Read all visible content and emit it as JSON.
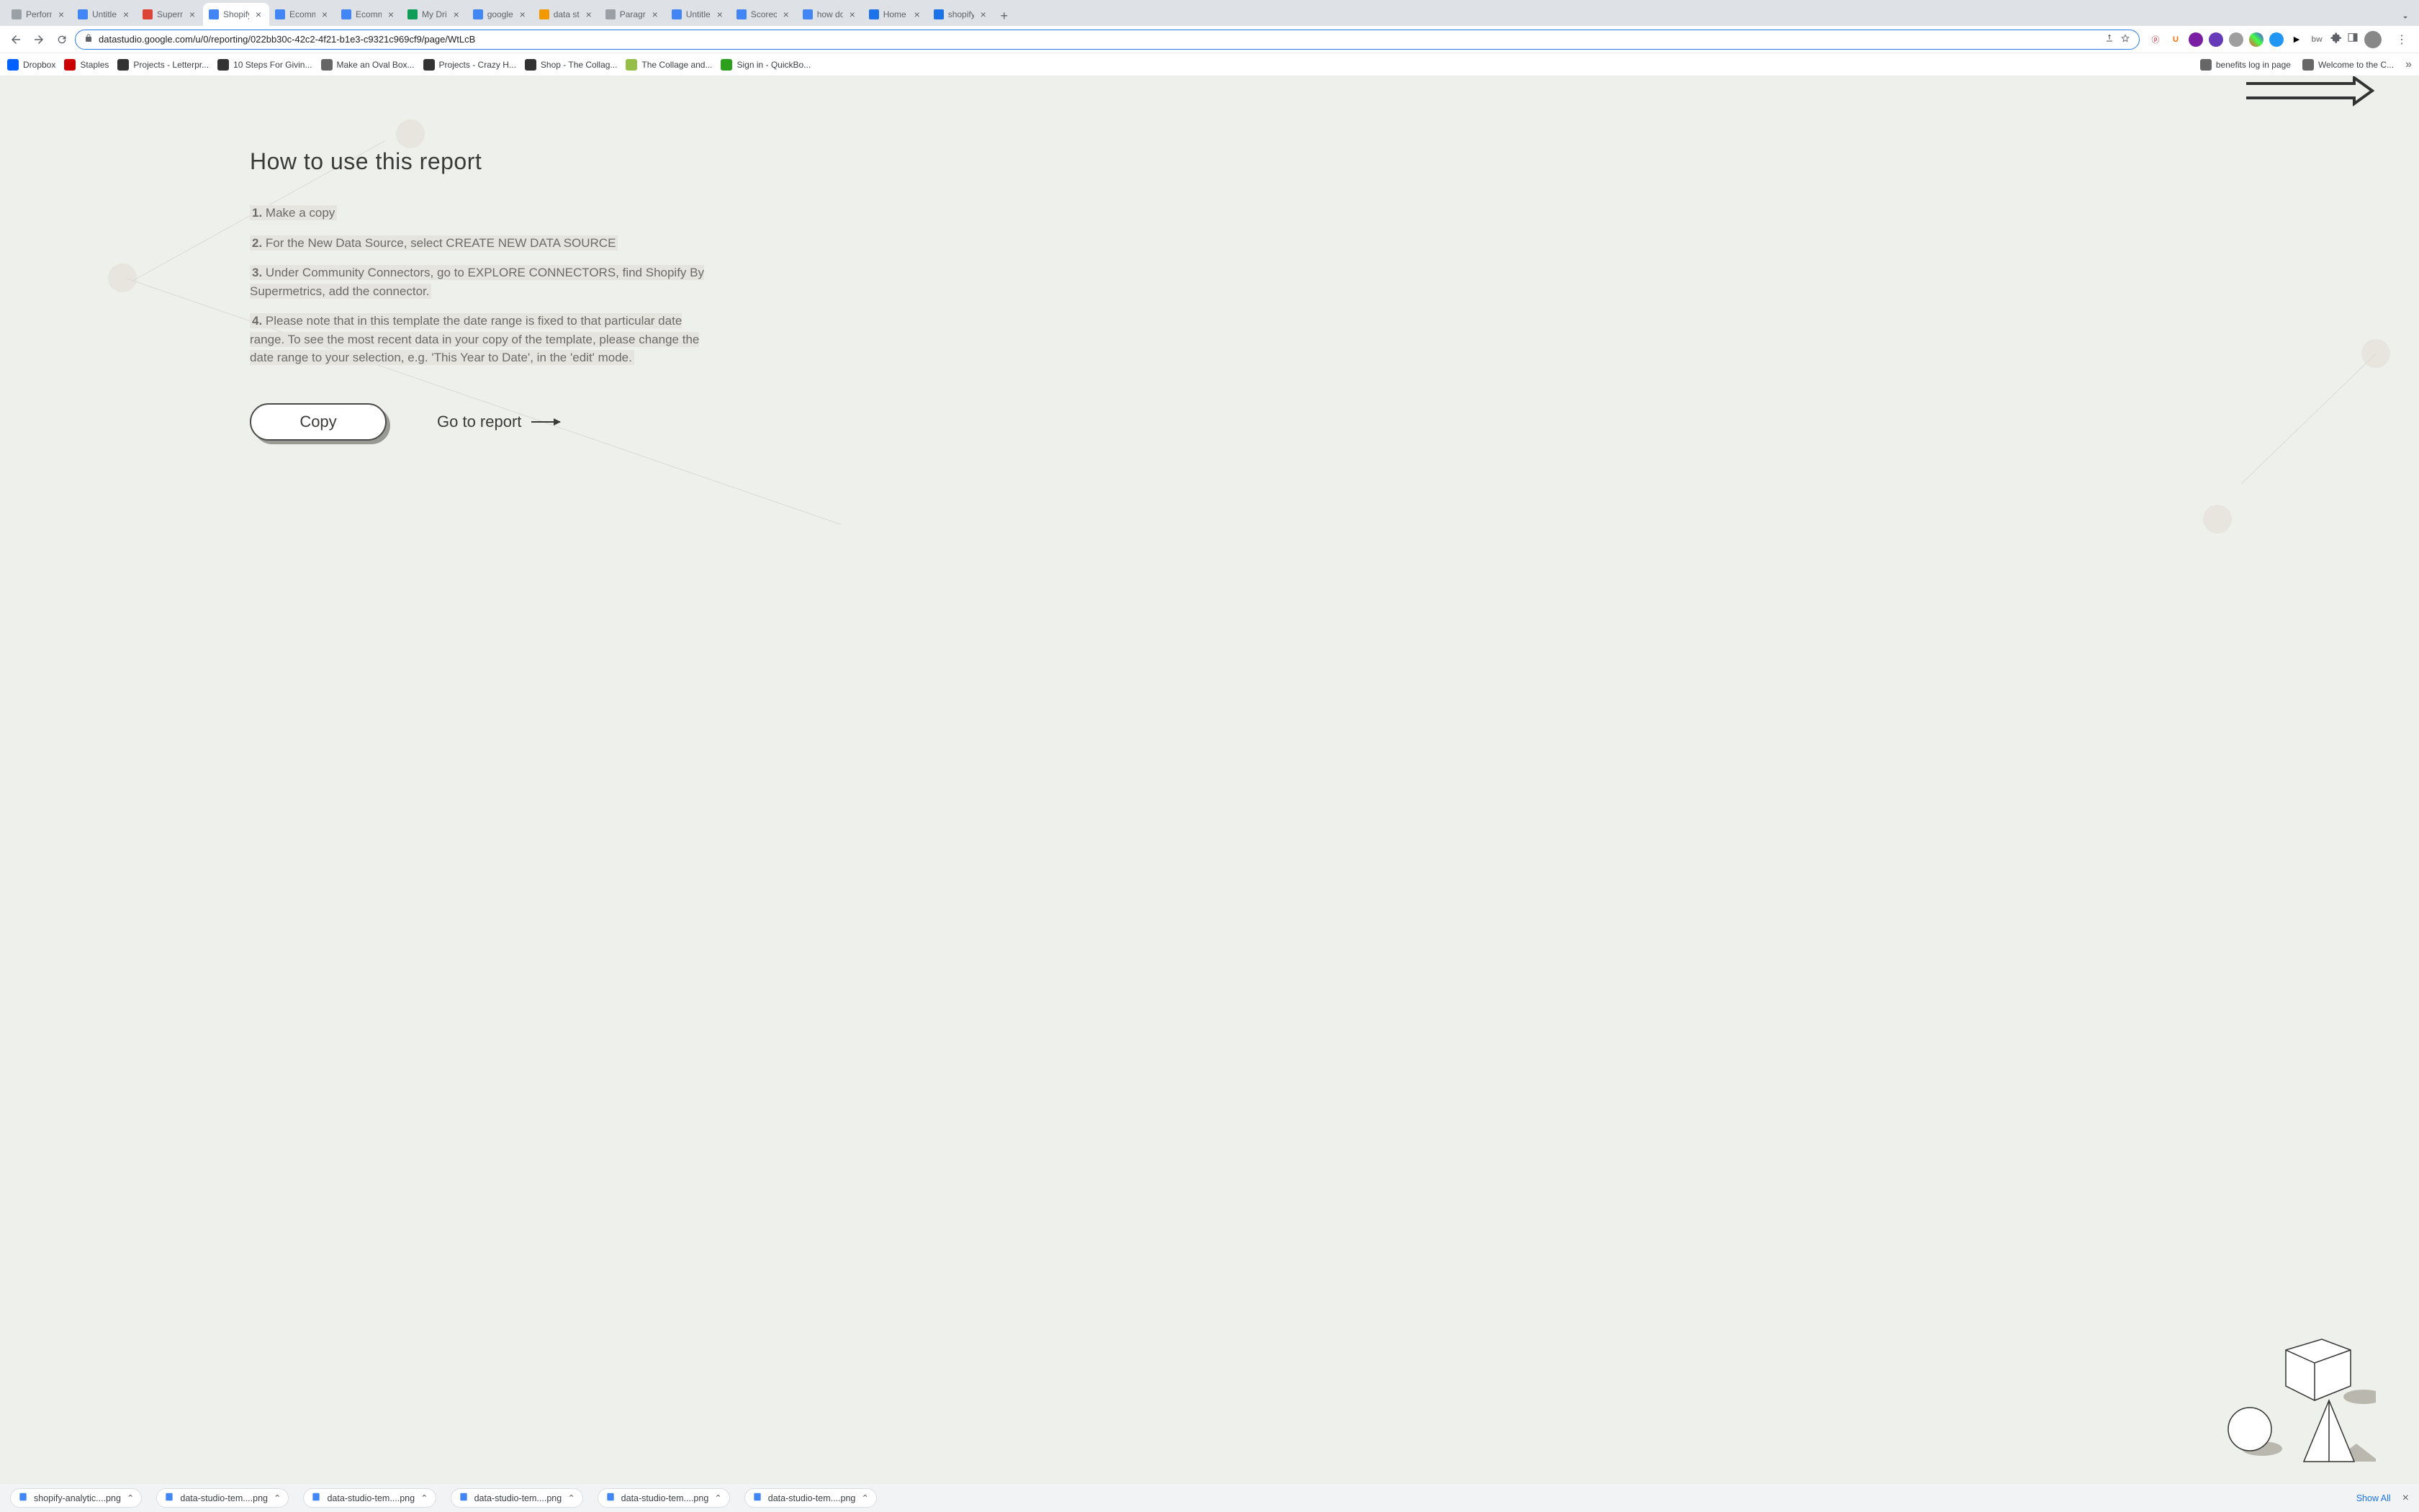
{
  "tabs": [
    {
      "title": "Perform",
      "favicon": "#9aa0a6"
    },
    {
      "title": "Untitle",
      "favicon": "#4285f4"
    },
    {
      "title": "Superm",
      "favicon": "#db4437"
    },
    {
      "title": "Shopify",
      "favicon": "#4285f4",
      "active": true
    },
    {
      "title": "Ecomm",
      "favicon": "#4285f4"
    },
    {
      "title": "Ecomm",
      "favicon": "#4285f4"
    },
    {
      "title": "My Dri",
      "favicon": "#0f9d58"
    },
    {
      "title": "google",
      "favicon": "#4285f4"
    },
    {
      "title": "data st",
      "favicon": "#f29900"
    },
    {
      "title": "Paragra",
      "favicon": "#9aa0a6"
    },
    {
      "title": "Untitle",
      "favicon": "#4285f4"
    },
    {
      "title": "Scorec",
      "favicon": "#4285f4"
    },
    {
      "title": "how do",
      "favicon": "#4285f4"
    },
    {
      "title": "Home",
      "favicon": "#1a73e8"
    },
    {
      "title": "shopify",
      "favicon": "#1a73e8"
    }
  ],
  "address": "datastudio.google.com/u/0/reporting/022bb30c-42c2-4f21-b1e3-c9321c969cf9/page/WtLcB",
  "bookmarks": [
    {
      "label": "Dropbox",
      "color": "#0061ff"
    },
    {
      "label": "Staples",
      "color": "#cc0000"
    },
    {
      "label": "Projects - Letterpr...",
      "color": "#333"
    },
    {
      "label": "10 Steps For Givin...",
      "color": "#333"
    },
    {
      "label": "Make an Oval Box...",
      "color": "#666"
    },
    {
      "label": "Projects - Crazy H...",
      "color": "#333"
    },
    {
      "label": "Shop - The Collag...",
      "color": "#333"
    },
    {
      "label": "The Collage and...",
      "color": "#95bf47"
    },
    {
      "label": "Sign in - QuickBo...",
      "color": "#2ca01c"
    }
  ],
  "bookmarks_right": [
    {
      "label": "benefits log in page"
    },
    {
      "label": "Welcome to the C..."
    }
  ],
  "report": {
    "title": "How to use this report",
    "step1_num": "1.",
    "step1": " Make a copy",
    "step2_num": "2.",
    "step2": " For the New Data Source, select CREATE NEW DATA SOURCE",
    "step3_num": "3.",
    "step3": " Under Community Connectors, go to EXPLORE CONNECTORS, find Shopify By Supermetrics, add the connector.",
    "step4_num": "4.",
    "step4": " Please note that in this template the date range is fixed to that particular date range. To see the most recent data in your copy of the template, please change the date range to your selection, e.g. 'This Year to Date', in the 'edit' mode.",
    "copy_label": "Copy",
    "goto_label": "Go to report"
  },
  "downloads": [
    {
      "name": "shopify-analytic....png"
    },
    {
      "name": "data-studio-tem....png"
    },
    {
      "name": "data-studio-tem....png"
    },
    {
      "name": "data-studio-tem....png"
    },
    {
      "name": "data-studio-tem....png"
    },
    {
      "name": "data-studio-tem....png"
    }
  ],
  "show_all": "Show All"
}
